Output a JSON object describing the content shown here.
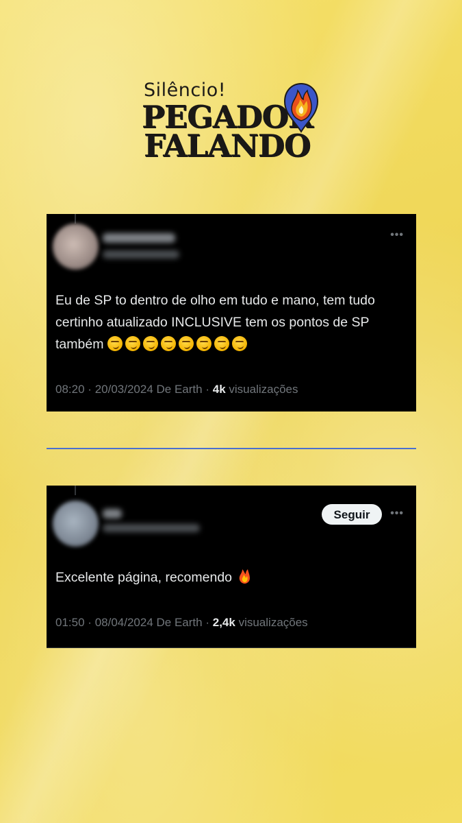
{
  "logo": {
    "line1": "Silêncio!",
    "line2": "PEGADOR",
    "line3": "FALANDO",
    "icon": "fire-location-pin-icon"
  },
  "colors": {
    "background": "#f2dc5e",
    "card": "#000000",
    "separator": "#4a6fd0",
    "meta_text": "#71767b"
  },
  "tweets": [
    {
      "text": "Eu de SP to dentro de olho em tudo e mano, tem tudo certinho atualizado INCLUSIVE tem os pontos de SP também",
      "emoji": "smirking-face",
      "emoji_count": 8,
      "time": "08:20",
      "date": "20/03/2024",
      "source": "De Earth",
      "views_count": "4k",
      "views_label": "visualizações"
    },
    {
      "follow_label": "Seguir",
      "text": "Excelente página, recomendo",
      "emoji": "fire",
      "time": "01:50",
      "date": "08/04/2024",
      "source": "De Earth",
      "views_count": "2,4k",
      "views_label": "visualizações"
    }
  ]
}
